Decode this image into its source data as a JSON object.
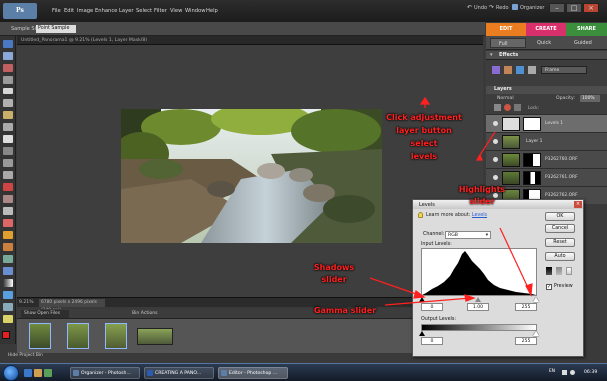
{
  "app": {
    "logo": "Ps",
    "menu": [
      "File",
      "Edit",
      "Image",
      "Enhance",
      "Layer",
      "Select",
      "Filter",
      "View",
      "Window",
      "Help"
    ],
    "undo": "Undo",
    "redo": "Redo",
    "organizer": "Organizer"
  },
  "options_bar": {
    "size_label": "Sample Size:",
    "size_value": "Point Sample"
  },
  "mode_tabs": {
    "edit": "EDIT",
    "create": "CREATE",
    "share": "SHARE"
  },
  "edit_tabs": {
    "full": "Full",
    "quick": "Quick",
    "guided": "Guided"
  },
  "document": {
    "title": "Untitled_Panorama1 @ 9.21% (Levels 1, Layer Mask/8)",
    "zoom": "9.21%",
    "info": "6780 pixels x 2496 pixels (240 ppi)"
  },
  "project_bin": {
    "show_open": "Show Open Files",
    "bin_actions": "Bin Actions",
    "hide": "Hide Project Bin"
  },
  "effects": {
    "label": "Effects",
    "frame": "Frame"
  },
  "layers": {
    "label": "Layers",
    "blend_mode": "Normal",
    "opacity_label": "Opacity:",
    "opacity_value": "100%",
    "lock_label": "Lock:",
    "rows": [
      {
        "name": "Levels 1"
      },
      {
        "name": "Layer 1"
      },
      {
        "name": "P3262760.ORF"
      },
      {
        "name": "P3262761.ORF"
      },
      {
        "name": "P3262762.ORF"
      }
    ]
  },
  "levels_dialog": {
    "title": "Levels",
    "learn_more": "Learn more about:",
    "learn_link": "Levels",
    "channel_label": "Channel:",
    "channel_value": "RGB",
    "input_label": "Input Levels:",
    "input_black": "0",
    "input_gamma": "1.00",
    "input_white": "255",
    "output_label": "Output Levels:",
    "output_black": "0",
    "output_white": "255",
    "buttons": {
      "ok": "OK",
      "cancel": "Cancel",
      "reset": "Reset",
      "auto": "Auto"
    },
    "preview_label": "Preview"
  },
  "annotations": {
    "adjust": [
      "Click adjustment",
      "layer button",
      "select",
      "levels"
    ],
    "highlights": [
      "Highlights",
      "slider"
    ],
    "shadows": [
      "Shadows",
      "slider"
    ],
    "gamma": "Gamma slider"
  },
  "taskbar": {
    "items": [
      "Organizer - Photosh...",
      "CREATING A PANO...",
      "Editor - Photoshop ..."
    ],
    "clock": "06:39",
    "tray": "EN"
  },
  "colors": {
    "edit": "#e97d1f",
    "create": "#d9306c",
    "share": "#3b8e3c",
    "annotation": "#ff2020"
  }
}
